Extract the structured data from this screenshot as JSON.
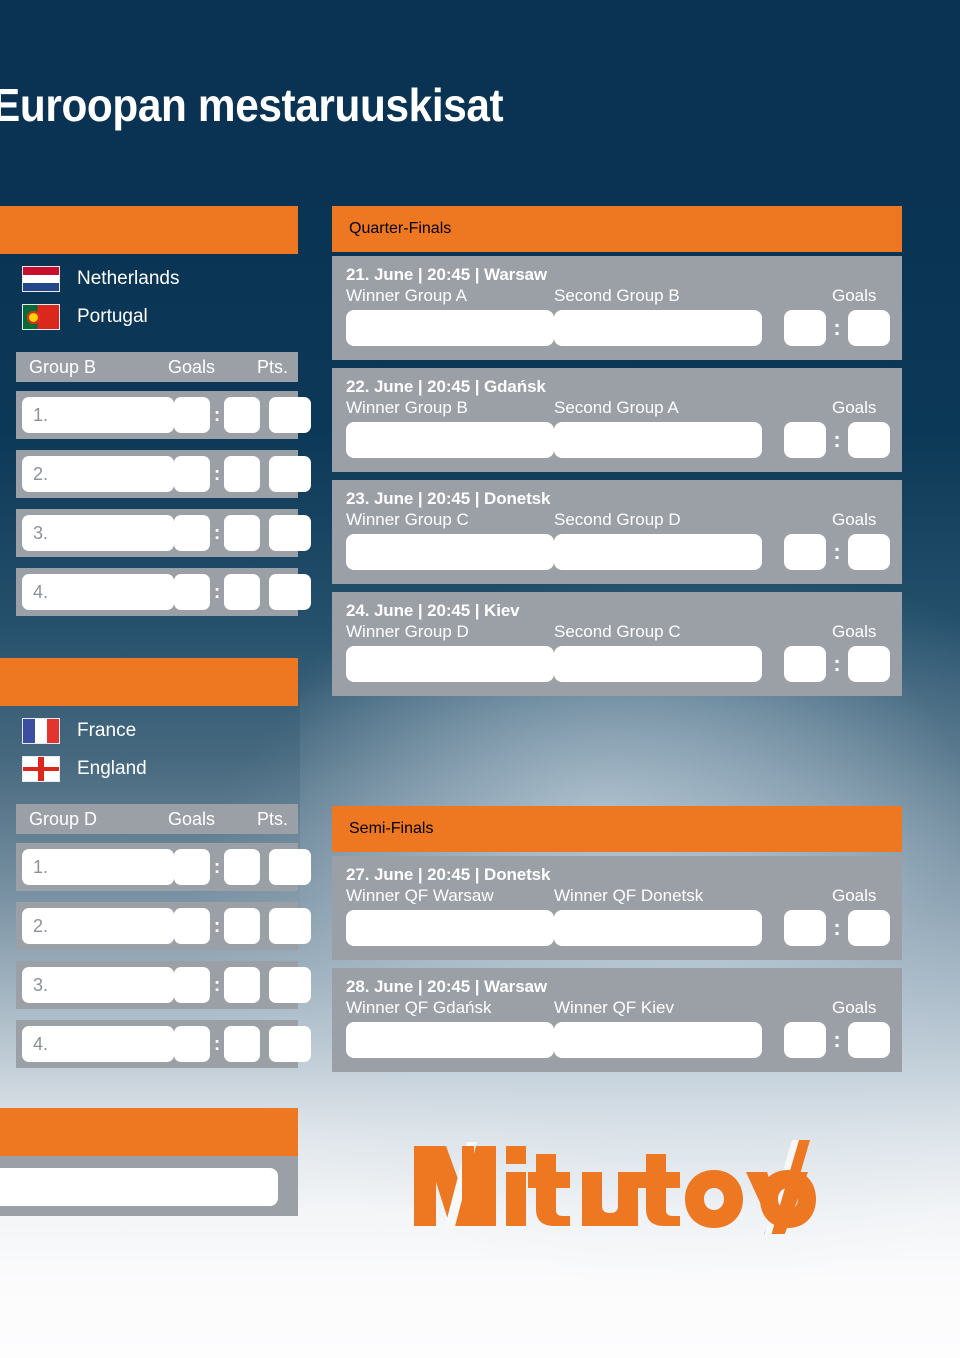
{
  "page": {
    "title": "Euroopan mestaruuskisat",
    "sponsor_logo": "Mitutoyo"
  },
  "colors": {
    "accent_orange": "#ee7722",
    "panel_gray": "#9b9fa6",
    "background_navy": "#0a3353",
    "text_white": "#ffffff"
  },
  "groups": [
    {
      "name": "Group B",
      "goals_header": "Goals",
      "points_header": "Pts.",
      "qualified": [
        {
          "team": "Netherlands",
          "flag": "flag-netherlands"
        },
        {
          "team": "Portugal",
          "flag": "flag-portugal"
        }
      ],
      "rows": [
        {
          "rank": "1.",
          "team": "",
          "goals_for": "",
          "separator": ":",
          "goals_against": "",
          "points": ""
        },
        {
          "rank": "2.",
          "team": "",
          "goals_for": "",
          "separator": ":",
          "goals_against": "",
          "points": ""
        },
        {
          "rank": "3.",
          "team": "",
          "goals_for": "",
          "separator": ":",
          "goals_against": "",
          "points": ""
        },
        {
          "rank": "4.",
          "team": "",
          "goals_for": "",
          "separator": ":",
          "goals_against": "",
          "points": ""
        }
      ]
    },
    {
      "name": "Group D",
      "goals_header": "Goals",
      "points_header": "Pts.",
      "qualified": [
        {
          "team": "France",
          "flag": "flag-france"
        },
        {
          "team": "England",
          "flag": "flag-england"
        }
      ],
      "rows": [
        {
          "rank": "1.",
          "team": "",
          "goals_for": "",
          "separator": ":",
          "goals_against": "",
          "points": ""
        },
        {
          "rank": "2.",
          "team": "",
          "goals_for": "",
          "separator": ":",
          "goals_against": "",
          "points": ""
        },
        {
          "rank": "3.",
          "team": "",
          "goals_for": "",
          "separator": ":",
          "goals_against": "",
          "points": ""
        },
        {
          "rank": "4.",
          "team": "",
          "goals_for": "",
          "separator": ":",
          "goals_against": "",
          "points": ""
        }
      ]
    }
  ],
  "quarter_finals": {
    "title": "Quarter-Finals",
    "matches": [
      {
        "meta": "21. June | 20:45 | Warsaw",
        "home_label": "Winner Group A",
        "away_label": "Second Group B",
        "goals_label": "Goals",
        "home_value": "",
        "away_value": "",
        "goals_home": "",
        "separator": ":",
        "goals_away": ""
      },
      {
        "meta": "22. June | 20:45 | Gdańsk",
        "home_label": "Winner Group B",
        "away_label": "Second Group A",
        "goals_label": "Goals",
        "home_value": "",
        "away_value": "",
        "goals_home": "",
        "separator": ":",
        "goals_away": ""
      },
      {
        "meta": "23. June | 20:45 | Donetsk",
        "home_label": "Winner Group C",
        "away_label": "Second Group D",
        "goals_label": "Goals",
        "home_value": "",
        "away_value": "",
        "goals_home": "",
        "separator": ":",
        "goals_away": ""
      },
      {
        "meta": "24. June | 20:45 | Kiev",
        "home_label": "Winner Group D",
        "away_label": "Second Group C",
        "goals_label": "Goals",
        "home_value": "",
        "away_value": "",
        "goals_home": "",
        "separator": ":",
        "goals_away": ""
      }
    ]
  },
  "semi_finals": {
    "title": "Semi-Finals",
    "matches": [
      {
        "meta": "27. June | 20:45 | Donetsk",
        "home_label": "Winner QF Warsaw",
        "away_label": "Winner QF Donetsk",
        "goals_label": "Goals",
        "home_value": "",
        "away_value": "",
        "goals_home": "",
        "separator": ":",
        "goals_away": ""
      },
      {
        "meta": "28. June | 20:45 | Warsaw",
        "home_label": "Winner QF Gdańsk",
        "away_label": "Winner QF Kiev",
        "goals_label": "Goals",
        "home_value": "",
        "away_value": "",
        "goals_home": "",
        "separator": ":",
        "goals_away": ""
      }
    ]
  }
}
